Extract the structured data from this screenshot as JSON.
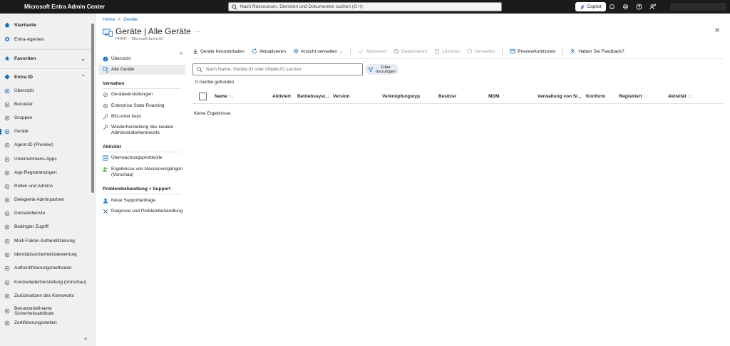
{
  "topbar": {
    "app_title": "Microsoft Entra Admin Center",
    "search_placeholder": "Nach Ressourcen, Diensten und Dokumenten suchen (G+/)",
    "copilot_label": "Copilot",
    "icons": [
      "bell-icon",
      "gear-icon",
      "help-icon",
      "feedback-icon"
    ]
  },
  "leftnav": {
    "startseite": "Startseite",
    "entra_agenten": "Entra-Agenten",
    "favoriten": "Favoriten",
    "entra_id": "Entra ID",
    "items": [
      {
        "label": "Übersicht",
        "icon": "info-icon"
      },
      {
        "label": "Benutzer",
        "icon": "user-icon"
      },
      {
        "label": "Gruppen",
        "icon": "group-icon"
      },
      {
        "label": "Geräte",
        "icon": "device-icon"
      },
      {
        "label": "Agent-ID (Preview)",
        "icon": "agent-icon"
      },
      {
        "label": "Unternehmens-Apps",
        "icon": "apps-icon"
      },
      {
        "label": "App-Registrierungen",
        "icon": "app-registration-icon"
      },
      {
        "label": "Rollen und Admins",
        "icon": "roles-icon"
      },
      {
        "label": "Delegierte Adminpartner",
        "icon": "partner-icon"
      },
      {
        "label": "Domaindienste",
        "icon": "domain-icon"
      },
      {
        "label": "Bedingter Zugriff",
        "icon": "lock-icon"
      },
      {
        "label": "Multi-Faktor-Authentifizierung",
        "icon": "mfa-icon"
      },
      {
        "label": "Identitätssicherheitsbewertung",
        "icon": "score-icon"
      },
      {
        "label": "Authentifizierungsmethoden",
        "icon": "key-icon"
      },
      {
        "label": "Kontowiederherstellung (Vorschau)",
        "icon": "recovery-icon"
      },
      {
        "label": "Zurücksetzen des Kennworts",
        "icon": "reset-icon"
      },
      {
        "label": "Benutzerdefinierte Sicherheitsattribute",
        "icon": "attribute-icon"
      },
      {
        "label": "Zertifizierungsstellen",
        "icon": "certificate-icon"
      }
    ]
  },
  "breadcrumb": {
    "home": "Home",
    "current": "Geräte",
    "separator": ">"
  },
  "page": {
    "title": "Geräte | Alle Geräte",
    "subtitle": "PHHIT – Microsoft Entra ID",
    "more": "…"
  },
  "subnav": {
    "top_items": [
      "Übersicht",
      "Alle Geräte"
    ],
    "verwalten_heading": "Verwalten",
    "verwalten_items": [
      "Geräteeinstellungen",
      "Enterprise State Roaming",
      "BitLocker keys",
      "Wiederherstellung des lokalen Administratorkennworts"
    ],
    "aktivitaet_heading": "Aktivität",
    "aktivitaet_items": [
      "Überwachungsprotokolle",
      "Ergebnisse von Massenvorgängen (Vorschau)"
    ],
    "support_heading": "Problembehandlung + Support",
    "support_items": [
      "Neue Supportanfrage",
      "Diagnose und Problembehandlung"
    ]
  },
  "toolbar": {
    "download": "Geräte herunterladen",
    "refresh": "Aktualisieren",
    "view": "Ansicht verwalten",
    "activate": "Aktivieren",
    "deactivate": "Deaktivieren",
    "delete": "Löschen",
    "manage": "Verwalten",
    "preview": "Previewfunktionen",
    "feedback": "Haben Sie Feedback?"
  },
  "filter": {
    "placeholder": "Nach Name, Geräte-ID oder Objekt-ID suchen",
    "button_line1": "Filter",
    "button_line2": "hinzufügen"
  },
  "result_count": "0 Geräte gefunden",
  "table": {
    "columns": [
      "Name",
      "Aktiviert",
      "Betriebssyst...",
      "Version",
      "Verknüpfungstyp",
      "Besitzer",
      "MDM",
      "Verwaltung von Si...",
      "Konform",
      "Registriert",
      "Aktivität"
    ],
    "sort_glyph": "↑↓",
    "empty_message": "Keine Ergebnisse."
  },
  "colors": {
    "accent": "#0f6cbd",
    "topbar": "#1b1b1b",
    "nav_bg": "#f0f0f0"
  }
}
